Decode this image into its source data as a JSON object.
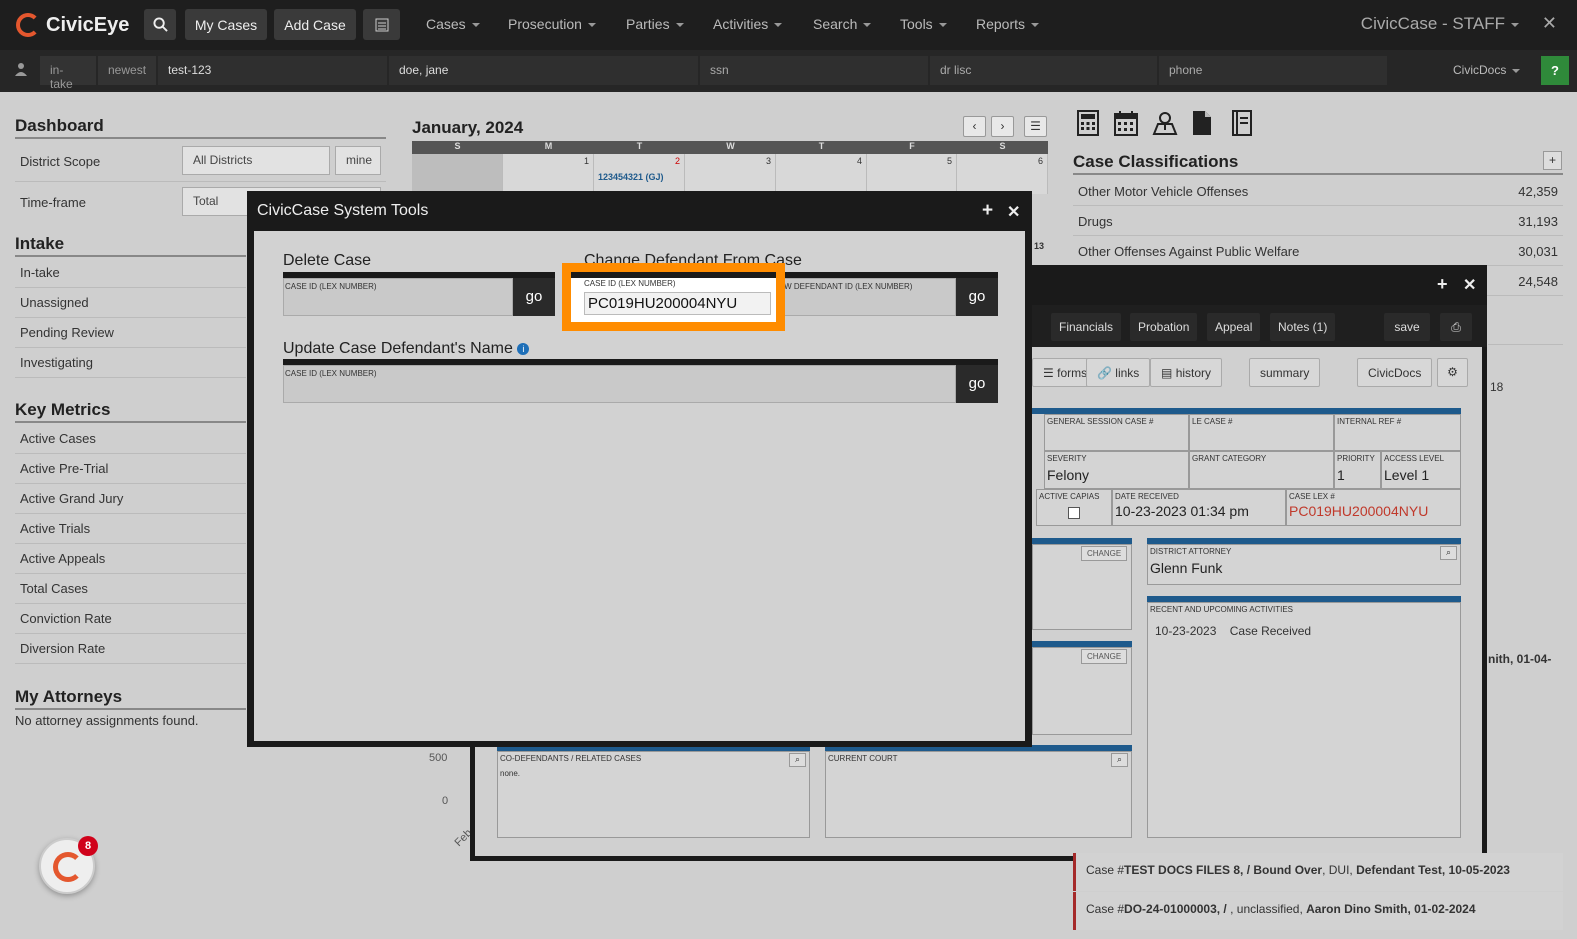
{
  "app": {
    "brand": "CivicEye",
    "title": "CivicCase - STAFF",
    "close_glyph": "✕"
  },
  "topnav": {
    "my_cases": "My Cases",
    "add_case": "Add Case",
    "menus": [
      "Cases",
      "Prosecution",
      "Parties",
      "Activities",
      "Search",
      "Tools",
      "Reports"
    ]
  },
  "searchbar": {
    "tag_intake": "in-take",
    "tag_newest": "newest",
    "case_value": "test-123",
    "name_value": "doe, jane",
    "ssn_placeholder": "ssn",
    "drlisc_placeholder": "dr lisc",
    "phone_placeholder": "phone",
    "civicdocs": "CivicDocs",
    "help": "?"
  },
  "dashboard": {
    "title": "Dashboard",
    "district_scope_label": "District Scope",
    "district_scope_value": "All Districts",
    "mine_label": "mine",
    "timeframe_label": "Time-frame",
    "timeframe_value": "Total",
    "intake_title": "Intake",
    "intake_items": [
      "In-take",
      "Unassigned",
      "Pending Review",
      "Investigating"
    ],
    "metrics_title": "Key Metrics",
    "metrics_items": [
      "Active Cases",
      "Active Pre-Trial",
      "Active Grand Jury",
      "Active Trials",
      "Active Appeals",
      "Total Cases",
      "Conviction Rate",
      "Diversion Rate"
    ],
    "attorneys_title": "My Attorneys",
    "attorneys_empty": "No attorney assignments found."
  },
  "calendar": {
    "title": "January, 2024",
    "days": [
      "S",
      "M",
      "T",
      "W",
      "T",
      "F",
      "S"
    ],
    "dates": [
      "",
      "1",
      "2",
      "3",
      "4",
      "5",
      "6"
    ],
    "event": "123454321 (GJ)",
    "extra_date": "13",
    "axis_500": "500",
    "axis_0": "0",
    "axis_feb": "Feb"
  },
  "classifications": {
    "title": "Case Classifications",
    "add": "+",
    "rows": [
      {
        "label": "Other Motor Vehicle Offenses",
        "count": "42,359"
      },
      {
        "label": "Drugs",
        "count": "31,193"
      },
      {
        "label": "Other Offenses Against Public Welfare",
        "count": "30,031"
      },
      {
        "label": "",
        "count": "24,548"
      }
    ]
  },
  "case_modal": {
    "tabs": [
      "Financials",
      "Probation",
      "Appeal",
      "Notes (1)"
    ],
    "save": "save",
    "sub_buttons": [
      "forms",
      "links",
      "history",
      "summary",
      "CivicDocs"
    ],
    "fields": {
      "gs_case_label": "GENERAL SESSION CASE #",
      "le_case_label": "LE CASE #",
      "internal_ref_label": "INTERNAL REF #",
      "severity_label": "SEVERITY",
      "severity_value": "Felony",
      "grant_label": "GRANT CATEGORY",
      "priority_label": "PRIORITY",
      "priority_value": "1",
      "access_label": "ACCESS LEVEL",
      "access_value": "Level 1",
      "capias_label": "ACTIVE CAPIAS",
      "date_received_label": "DATE RECEIVED",
      "date_received_value": "10-23-2023 01:34 pm",
      "case_lex_label": "CASE LEX #",
      "case_lex_value": "PC019HU200004NYU",
      "da_label": "DISTRICT ATTORNEY",
      "da_value": "Glenn Funk",
      "activities_label": "RECENT AND UPCOMING ACTIVITIES",
      "activity_date": "10-23-2023",
      "activity_name": "Case Received",
      "change": "CHANGE",
      "codef_label": "CO-DEFENDANTS / RELATED CASES",
      "codef_value": "none.",
      "court_label": "CURRENT COURT"
    },
    "side_partials": [
      "18",
      "nith, 01-04-"
    ]
  },
  "tools_modal": {
    "title": "CivicCase System Tools",
    "delete_title": "Delete Case",
    "change_title": "Change Defendant From Case",
    "update_title": "Update Case Defendant's Name",
    "case_id_label": "CASE ID (LEX NUMBER)",
    "new_def_label": "NEW DEFENDANT ID (LEX NUMBER)",
    "change_case_value": "PC019HU200004NYU",
    "go": "go"
  },
  "bottom_list": [
    {
      "prefix": "Case #",
      "case": "TEST DOCS FILES 8, / Bound Over",
      "rest": ", DUI, ",
      "who": "Defendant Test, 10-05-2023"
    },
    {
      "prefix": "Case #",
      "case": "DO-24-01000003, /",
      "rest": " , unclassified, ",
      "who": "Aaron Dino Smith, 01-02-2024"
    }
  ],
  "badge_count": "8",
  "colors": {
    "highlight": "#ff8c00",
    "accent_blue": "#1e5a8c",
    "help_green": "#2f8a3a",
    "brand_orange": "#e4572e"
  }
}
